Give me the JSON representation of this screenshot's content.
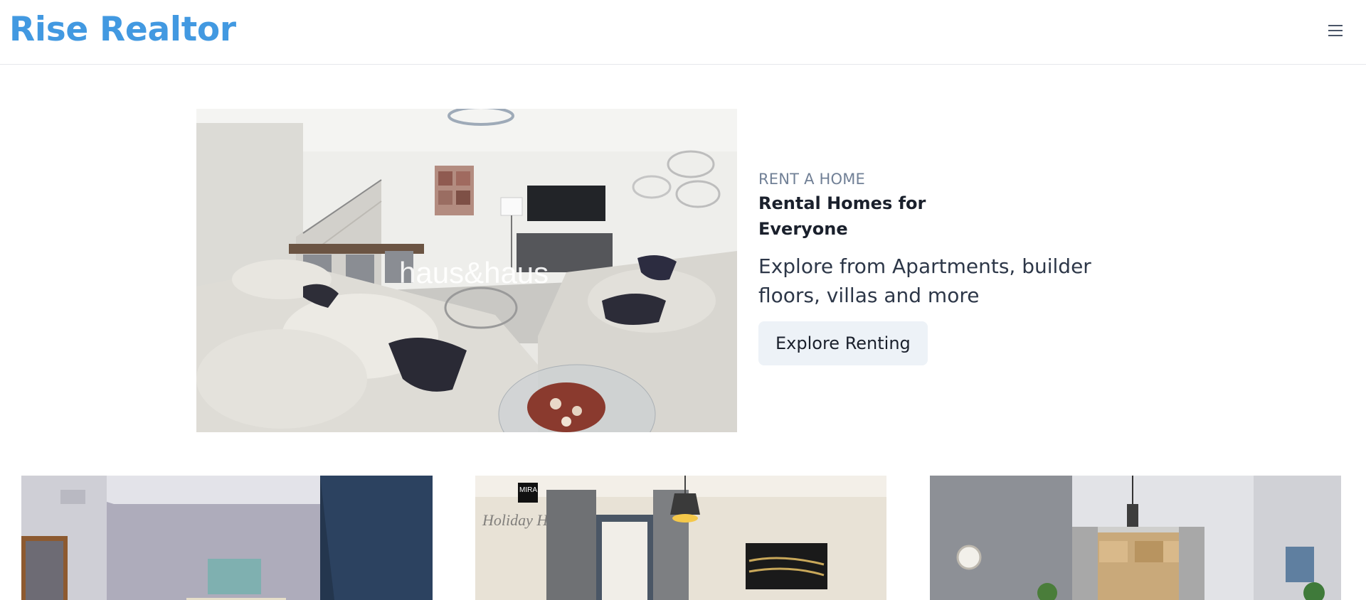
{
  "header": {
    "brand": "Rise Realtor",
    "menu_icon": "hamburger-menu-icon"
  },
  "hero": {
    "eyebrow": "RENT A HOME",
    "title": "Rental Homes for Everyone",
    "description": "Explore from Apartments, builder floors, villas and more",
    "cta_label": "Explore Renting",
    "image_watermark": "haus&haus"
  },
  "cards": [
    {
      "name": "listing-card-1",
      "image": "bedroom-photo"
    },
    {
      "name": "listing-card-2",
      "image": "living-room-photo",
      "logo_text": "MIRA",
      "watermark": "Holiday Homes"
    },
    {
      "name": "listing-card-3",
      "image": "living-room-photo"
    }
  ],
  "colors": {
    "brand": "#4299e1",
    "cta_bg": "#edf2f7",
    "text_muted": "#718096"
  }
}
